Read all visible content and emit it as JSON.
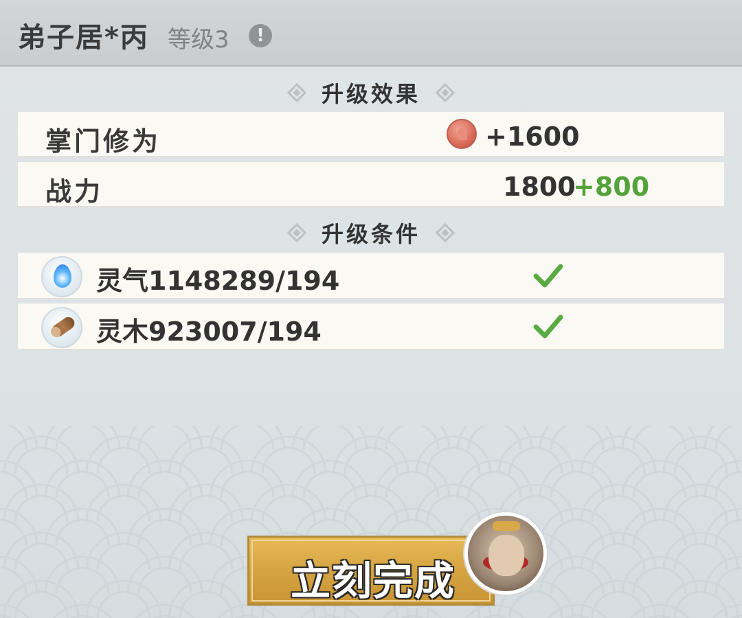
{
  "header": {
    "title": "弟子居*丙",
    "level": "等级3",
    "info_icon": "info-icon"
  },
  "effects": {
    "section_title": "升级效果",
    "rows": [
      {
        "label": "掌门修为",
        "icon": "meditation-icon",
        "value": "+1600"
      },
      {
        "label": "战力",
        "value": "1800",
        "bonus": "+800"
      }
    ]
  },
  "conditions": {
    "section_title": "升级条件",
    "rows": [
      {
        "icon": "spirit-qi-icon",
        "text": "灵气1148289/194",
        "met": true
      },
      {
        "icon": "spirit-wood-icon",
        "text": "灵木923007/194",
        "met": true
      }
    ]
  },
  "action": {
    "button_label": "立刻完成",
    "avatar": "monkey-king-avatar"
  },
  "colors": {
    "accent_green": "#54a23a",
    "button_gold": "#d6a442"
  }
}
